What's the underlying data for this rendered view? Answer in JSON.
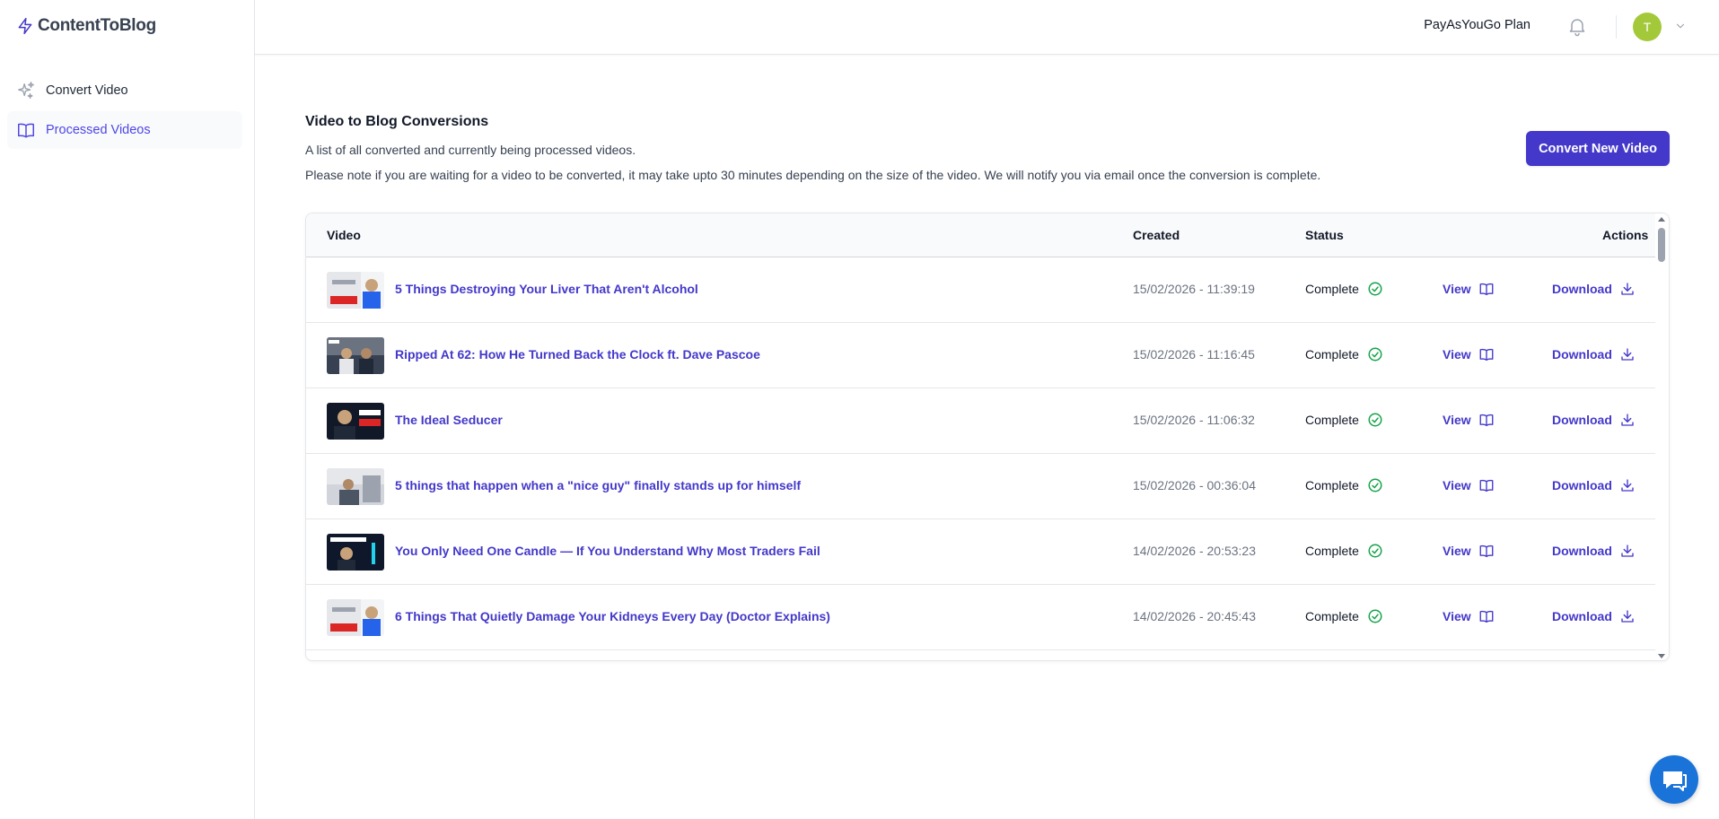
{
  "app": {
    "name": "ContentToBlog"
  },
  "sidebar": {
    "items": [
      {
        "label": "Convert Video",
        "icon": "sparkles-icon",
        "active": false
      },
      {
        "label": "Processed Videos",
        "icon": "book-open-icon",
        "active": true
      }
    ]
  },
  "header": {
    "plan": "PayAsYouGo Plan",
    "avatar_initial": "T"
  },
  "main": {
    "title": "Video to Blog Conversions",
    "subtitle": "A list of all converted and currently being processed videos.",
    "note": "Please note if you are waiting for a video to be converted, it may take upto 30 minutes depending on the size of the video. We will notify you via email once the conversion is complete.",
    "new_button": "Convert New Video",
    "columns": {
      "video": "Video",
      "created": "Created",
      "status": "Status",
      "actions": "Actions"
    },
    "rows": [
      {
        "title": "5 Things Destroying Your Liver That Aren't Alcohol",
        "created": "15/02/2026 - 11:39:19",
        "status": "Complete",
        "view": "View",
        "download": "Download"
      },
      {
        "title": "Ripped At 62: How He Turned Back the Clock ft. Dave Pascoe",
        "created": "15/02/2026 - 11:16:45",
        "status": "Complete",
        "view": "View",
        "download": "Download"
      },
      {
        "title": "The Ideal Seducer",
        "created": "15/02/2026 - 11:06:32",
        "status": "Complete",
        "view": "View",
        "download": "Download"
      },
      {
        "title": "5 things that happen when a \"nice guy\" finally stands up for himself",
        "created": "15/02/2026 - 00:36:04",
        "status": "Complete",
        "view": "View",
        "download": "Download"
      },
      {
        "title": "You Only Need One Candle — If You Understand Why Most Traders Fail",
        "created": "14/02/2026 - 20:53:23",
        "status": "Complete",
        "view": "View",
        "download": "Download"
      },
      {
        "title": "6 Things That Quietly Damage Your Kidneys Every Day (Doctor Explains)",
        "created": "14/02/2026 - 20:45:43",
        "status": "Complete",
        "view": "View",
        "download": "Download"
      }
    ]
  },
  "colors": {
    "accent": "#4338ca",
    "status_complete": "#16a34a",
    "avatar": "#a3c93a",
    "chat": "#1a73d9"
  }
}
